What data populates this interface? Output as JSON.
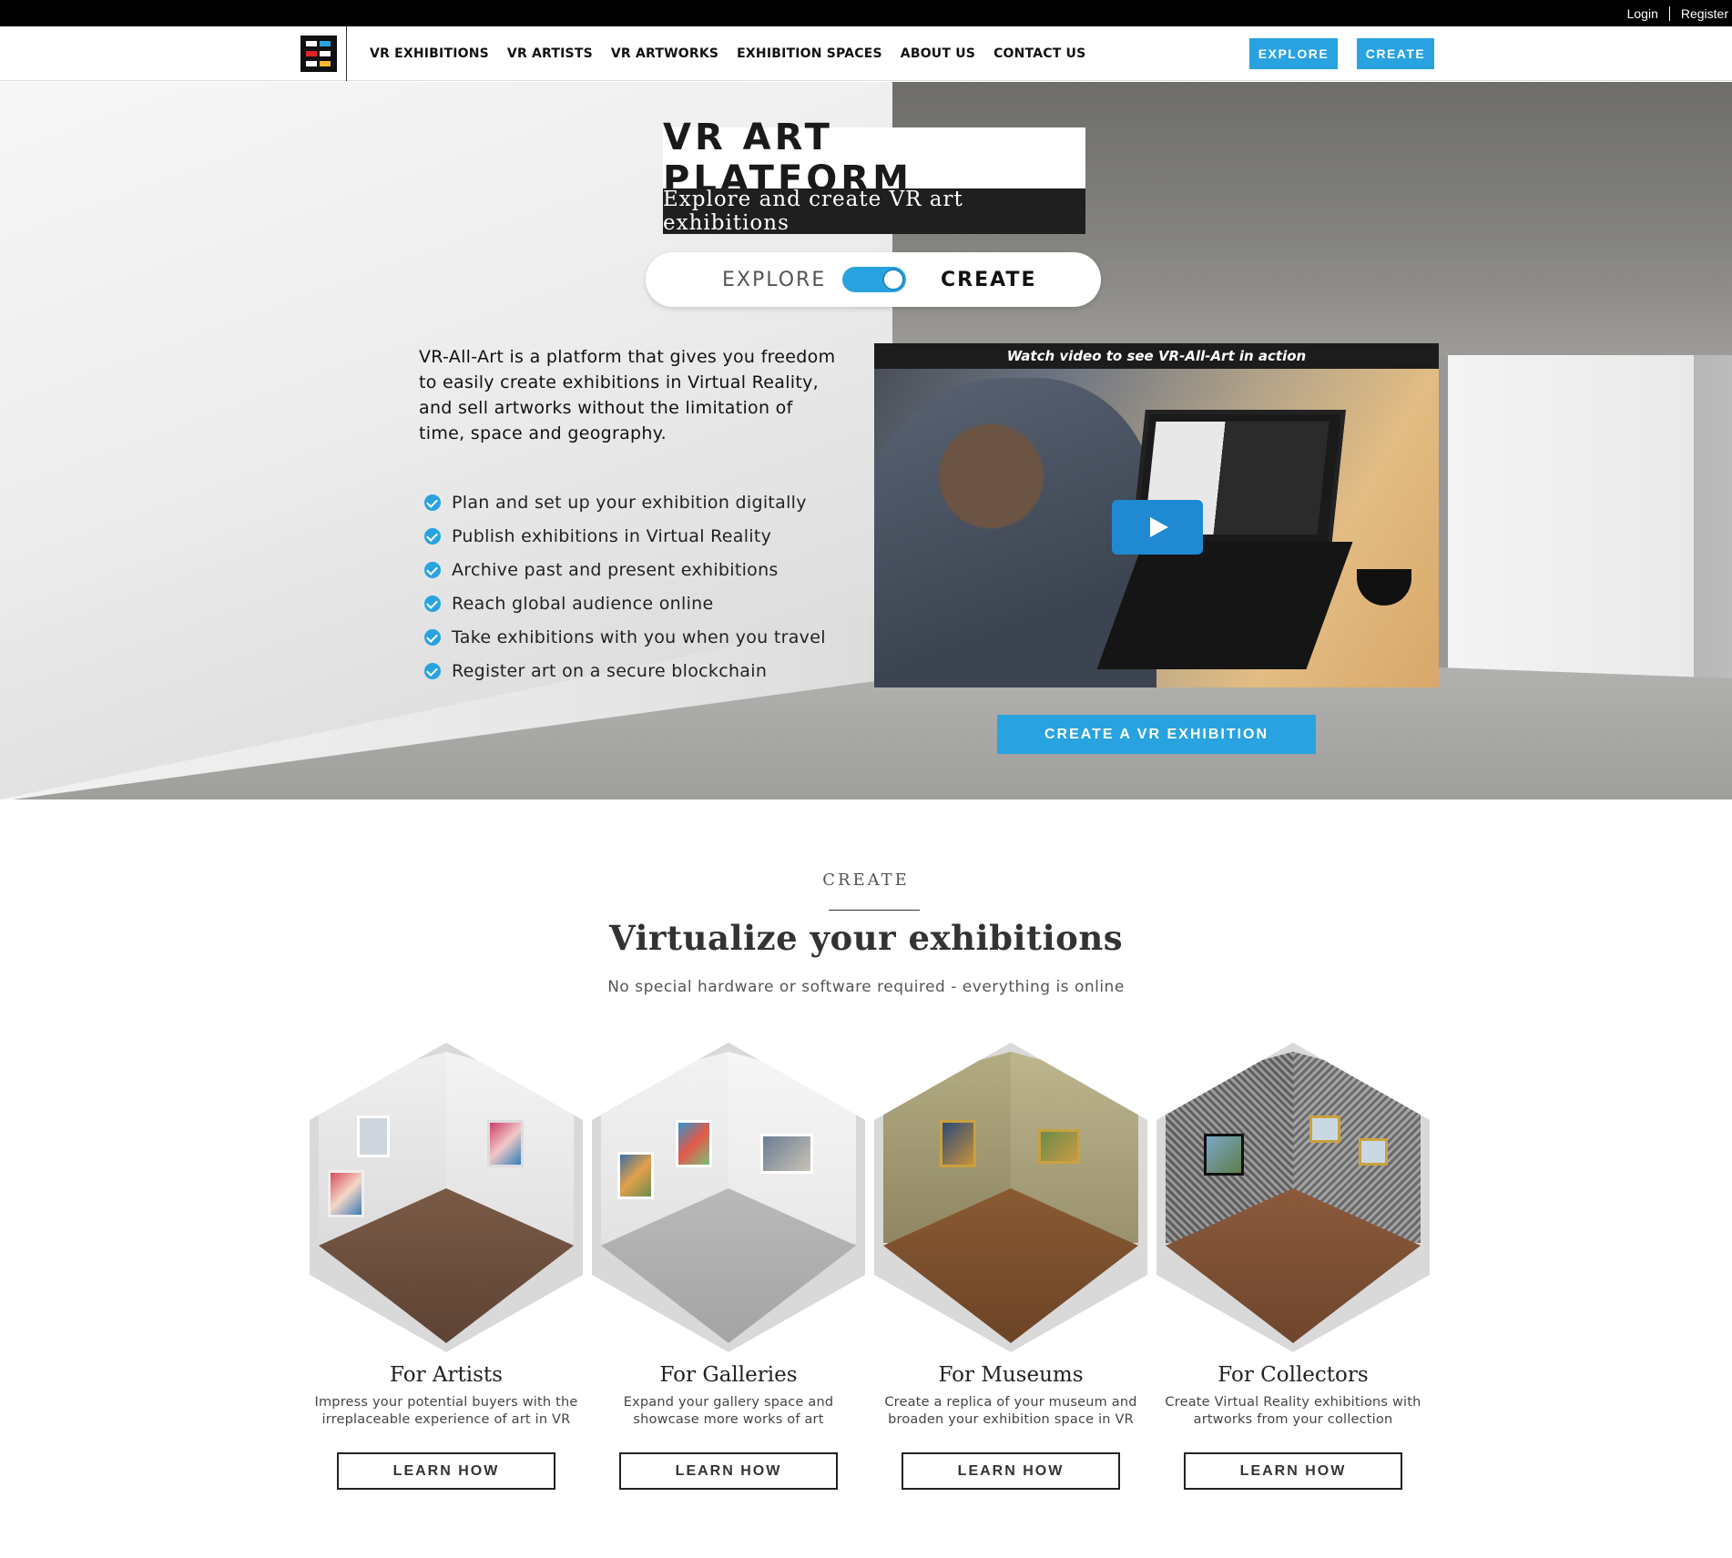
{
  "topbar": {
    "login": "Login",
    "register": "Register"
  },
  "nav": {
    "logo_icon": "grid-logo-icon",
    "items": [
      {
        "label": "VR EXHIBITIONS"
      },
      {
        "label": "VR ARTISTS"
      },
      {
        "label": "VR ARTWORKS"
      },
      {
        "label": "EXHIBITION SPACES"
      },
      {
        "label": "ABOUT US"
      },
      {
        "label": "CONTACT US"
      }
    ],
    "explore_button": "EXPLORE",
    "create_button": "CREATE"
  },
  "hero": {
    "title": "VR ART PLATFORM",
    "subtitle": "Explore and create VR art exhibitions",
    "toggle": {
      "left_label": "EXPLORE",
      "right_label": "CREATE",
      "selected": "CREATE"
    },
    "intro": "VR-All-Art is a platform that gives you freedom to easily create exhibitions in Virtual Reality, and sell artworks without the limitation of time, space and geography.",
    "features": [
      "Plan and set up your exhibition digitally",
      "Publish exhibitions in Virtual Reality",
      "Archive past and present exhibitions",
      "Reach global audience online",
      "Take exhibitions with you when you travel",
      "Register art on a secure blockchain"
    ],
    "video_caption": "Watch video to see VR-All-Art in action",
    "cta": "CREATE A VR EXHIBITION"
  },
  "create_section": {
    "kicker": "CREATE",
    "title": "Virtualize your exhibitions",
    "subtitle": "No special hardware or software required - everything is online",
    "cards": [
      {
        "title": "For Artists",
        "description": "Impress your potential buyers with the irreplaceable experience of art in VR",
        "button": "LEARN HOW"
      },
      {
        "title": "For Galleries",
        "description": "Expand your gallery space and showcase more works of art",
        "button": "LEARN HOW"
      },
      {
        "title": "For Museums",
        "description": "Create a replica of your museum and broaden your exhibition space in VR",
        "button": "LEARN HOW"
      },
      {
        "title": "For Collectors",
        "description": "Create Virtual Reality exhibitions with artworks from your collection",
        "button": "LEARN HOW"
      }
    ]
  },
  "colors": {
    "accent": "#29a3e0",
    "dark": "#1f1f1f"
  }
}
